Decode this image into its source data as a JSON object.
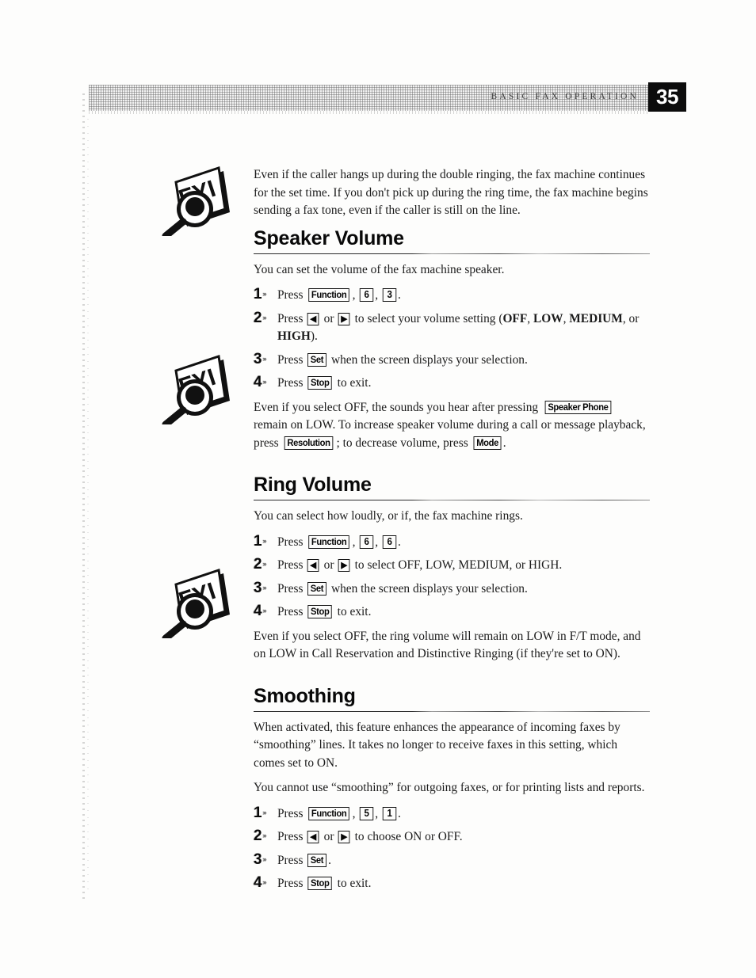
{
  "header": {
    "running_title": "BASIC FAX OPERATION",
    "page_number": "35",
    "page_number_bg": "#0c0c0c"
  },
  "icons": {
    "fyi_label": "FYI",
    "fyi_name": "fyi-magnifier-icon"
  },
  "intro_note": {
    "text": "Even if the caller hangs up during the double ringing, the fax machine continues for the set time. If you don't pick up during the ring time, the fax machine begins sending a fax tone, even if the caller is still on the line."
  },
  "sections": [
    {
      "heading": "Speaker Volume",
      "intro": "You can set the volume of the fax machine speaker.",
      "steps": [
        {
          "num": "1",
          "parts": [
            {
              "type": "text",
              "value": "Press "
            },
            {
              "type": "key",
              "value": "Function"
            },
            {
              "type": "text",
              "value": ", "
            },
            {
              "type": "key-num",
              "value": "6"
            },
            {
              "type": "text",
              "value": ", "
            },
            {
              "type": "key-num",
              "value": "3"
            },
            {
              "type": "text",
              "value": "."
            }
          ]
        },
        {
          "num": "2",
          "parts": [
            {
              "type": "text",
              "value": "Press "
            },
            {
              "type": "key-arrow",
              "value": "◀"
            },
            {
              "type": "text",
              "value": " or "
            },
            {
              "type": "key-arrow",
              "value": "▶"
            },
            {
              "type": "text",
              "value": " to select your volume setting ("
            },
            {
              "type": "bold",
              "value": "OFF"
            },
            {
              "type": "text",
              "value": ", "
            },
            {
              "type": "bold",
              "value": "LOW"
            },
            {
              "type": "text",
              "value": ", "
            },
            {
              "type": "bold",
              "value": "MEDIUM"
            },
            {
              "type": "text",
              "value": ", or "
            },
            {
              "type": "bold",
              "value": "HIGH"
            },
            {
              "type": "text",
              "value": ")."
            }
          ]
        },
        {
          "num": "3",
          "parts": [
            {
              "type": "text",
              "value": "Press "
            },
            {
              "type": "key",
              "value": "Set"
            },
            {
              "type": "text",
              "value": " when the screen displays your selection."
            }
          ]
        },
        {
          "num": "4",
          "parts": [
            {
              "type": "text",
              "value": "Press "
            },
            {
              "type": "key",
              "value": "Stop"
            },
            {
              "type": "text",
              "value": " to exit."
            }
          ]
        }
      ],
      "note_parts": [
        {
          "type": "text",
          "value": "Even if you select OFF, the sounds you hear after pressing "
        },
        {
          "type": "key",
          "value": "Speaker Phone"
        },
        {
          "type": "text",
          "value": " remain on LOW. To increase speaker volume during a call or message playback, press "
        },
        {
          "type": "key",
          "value": "Resolution"
        },
        {
          "type": "text",
          "value": "; to decrease volume, press "
        },
        {
          "type": "key",
          "value": "Mode"
        },
        {
          "type": "text",
          "value": "."
        }
      ]
    },
    {
      "heading": "Ring Volume",
      "intro": "You can select how loudly, or if, the fax machine rings.",
      "steps": [
        {
          "num": "1",
          "parts": [
            {
              "type": "text",
              "value": "Press "
            },
            {
              "type": "key",
              "value": "Function"
            },
            {
              "type": "text",
              "value": ", "
            },
            {
              "type": "key-num",
              "value": "6"
            },
            {
              "type": "text",
              "value": ", "
            },
            {
              "type": "key-num",
              "value": "6"
            },
            {
              "type": "text",
              "value": "."
            }
          ]
        },
        {
          "num": "2",
          "parts": [
            {
              "type": "text",
              "value": "Press "
            },
            {
              "type": "key-arrow",
              "value": "◀"
            },
            {
              "type": "text",
              "value": " or "
            },
            {
              "type": "key-arrow",
              "value": "▶"
            },
            {
              "type": "text",
              "value": " to select OFF, LOW, MEDIUM, or HIGH."
            }
          ]
        },
        {
          "num": "3",
          "parts": [
            {
              "type": "text",
              "value": "Press "
            },
            {
              "type": "key",
              "value": "Set"
            },
            {
              "type": "text",
              "value": " when the screen displays your selection."
            }
          ]
        },
        {
          "num": "4",
          "parts": [
            {
              "type": "text",
              "value": "Press "
            },
            {
              "type": "key",
              "value": "Stop"
            },
            {
              "type": "text",
              "value": " to exit."
            }
          ]
        }
      ],
      "note_parts": [
        {
          "type": "text",
          "value": "Even if you select OFF, the ring volume will remain on LOW in F/T mode, and on LOW in Call Reservation and Distinctive Ringing (if they're set to ON)."
        }
      ]
    },
    {
      "heading": "Smoothing",
      "intro": "When activated, this feature enhances the appearance of incoming faxes by “smoothing” lines. It takes no longer to receive faxes in this setting, which comes set to ON.",
      "intro2": "You cannot use “smoothing” for outgoing faxes, or for printing lists and reports.",
      "steps": [
        {
          "num": "1",
          "parts": [
            {
              "type": "text",
              "value": "Press "
            },
            {
              "type": "key",
              "value": "Function"
            },
            {
              "type": "text",
              "value": ", "
            },
            {
              "type": "key-num",
              "value": "5"
            },
            {
              "type": "text",
              "value": ", "
            },
            {
              "type": "key-num",
              "value": "1"
            },
            {
              "type": "text",
              "value": "."
            }
          ]
        },
        {
          "num": "2",
          "parts": [
            {
              "type": "text",
              "value": "Press "
            },
            {
              "type": "key-arrow",
              "value": "◀"
            },
            {
              "type": "text",
              "value": " or "
            },
            {
              "type": "key-arrow",
              "value": "▶"
            },
            {
              "type": "text",
              "value": " to choose ON or OFF."
            }
          ]
        },
        {
          "num": "3",
          "parts": [
            {
              "type": "text",
              "value": "Press "
            },
            {
              "type": "key",
              "value": "Set"
            },
            {
              "type": "text",
              "value": "."
            }
          ]
        },
        {
          "num": "4",
          "parts": [
            {
              "type": "text",
              "value": "Press "
            },
            {
              "type": "key",
              "value": "Stop"
            },
            {
              "type": "text",
              "value": " to exit."
            }
          ]
        }
      ],
      "note_parts": []
    }
  ]
}
